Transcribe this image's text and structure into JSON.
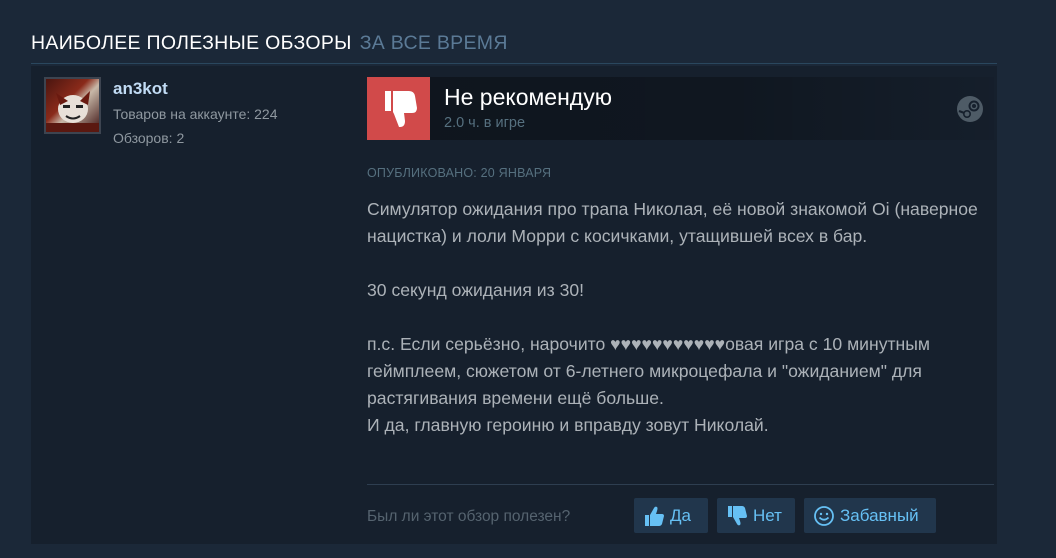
{
  "header": {
    "title": "НАИБОЛЕЕ ПОЛЕЗНЫЕ ОБЗОРЫ",
    "period": "ЗА ВСЕ ВРЕМЯ"
  },
  "author": {
    "name": "an3kot",
    "products": "Товаров на аккаунте: 224",
    "reviews": "Обзоров: 2"
  },
  "review": {
    "verdict": "Не рекомендую",
    "hours": "2.0 ч. в игре",
    "posted": "ОПУБЛИКОВАНО: 20 ЯНВАРЯ",
    "paragraphs": [
      "Симулятор ожидания про трапа Николая, её новой знакомой Oi (наверное нацистка) и лоли Морри с косичками, утащившей всех в бар.",
      "30 секунд ожидания из 30!",
      "п.с. Если серьёзно, нарочито ♥♥♥♥♥♥♥♥♥♥♥овая игра с 10 минутным геймплеем, сюжетом от 6-летнего микроцефала и \"ожиданием\" для растягивания времени ещё больше.",
      "И да, главную героиню и вправду зовут Николай."
    ],
    "icons": {
      "verdict": "thumbs-down-icon",
      "platform": "steam-icon"
    },
    "colors": {
      "negative": "#d14a4a",
      "link": "#66c0f4"
    }
  },
  "footer": {
    "question": "Был ли этот обзор полезен?",
    "yes": "Да",
    "no": "Нет",
    "funny": "Забавный"
  }
}
